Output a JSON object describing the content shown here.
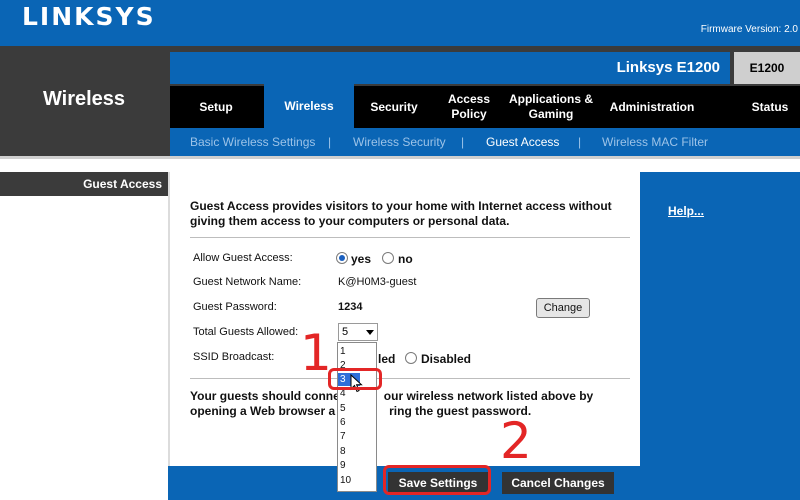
{
  "header": {
    "logo": "LINKSYS",
    "firmware": "Firmware Version: 2.0",
    "model_name": "Linksys E1200",
    "model_code": "E1200"
  },
  "section_title": "Wireless",
  "nav": {
    "tabs": [
      {
        "label": "Setup"
      },
      {
        "label": "Wireless",
        "active": true
      },
      {
        "label": "Security"
      },
      {
        "label": "Access Policy"
      },
      {
        "label": "Applications & Gaming"
      },
      {
        "label": "Administration"
      },
      {
        "label": "Status"
      }
    ]
  },
  "subnav": {
    "items": [
      {
        "label": "Basic Wireless Settings"
      },
      {
        "label": "Wireless Security"
      },
      {
        "label": "Guest Access",
        "active": true
      },
      {
        "label": "Wireless MAC Filter"
      }
    ],
    "separator": "|"
  },
  "left_panel": {
    "header": "Guest Access"
  },
  "help": {
    "label": "Help..."
  },
  "form": {
    "intro": "Guest Access provides visitors to your home with Internet access without giving them access to your computers or personal data.",
    "allow_label": "Allow Guest Access:",
    "allow_yes": "yes",
    "allow_no": "no",
    "allow_value": "yes",
    "network_name_label": "Guest Network Name:",
    "network_name_value": "K@H0M3-guest",
    "password_label": "Guest Password:",
    "password_value": "1234",
    "change_button": "Change",
    "total_label": "Total Guests Allowed:",
    "total_value": "5",
    "ssid_label": "SSID Broadcast:",
    "ssid_enabled_partial": "led",
    "ssid_disabled": "Disabled",
    "dropdown_options": [
      "1",
      "2",
      "3",
      "4",
      "5",
      "6",
      "7",
      "8",
      "9",
      "10"
    ],
    "dropdown_highlighted": "3",
    "note_line1_left": "Your guests should conne",
    "note_line1_right": "our wireless network listed above by",
    "note_line2_left": "opening a Web browser a",
    "note_line2_right": "ring the guest password."
  },
  "buttons": {
    "save": "Save Settings",
    "cancel": "Cancel Changes"
  },
  "annotations": {
    "step1": "1",
    "step2": "2",
    "color": "#e32626"
  },
  "colors": {
    "brand_blue": "#0a65b5",
    "dark_band": "#3b3b3b",
    "nav_black": "#000000"
  }
}
